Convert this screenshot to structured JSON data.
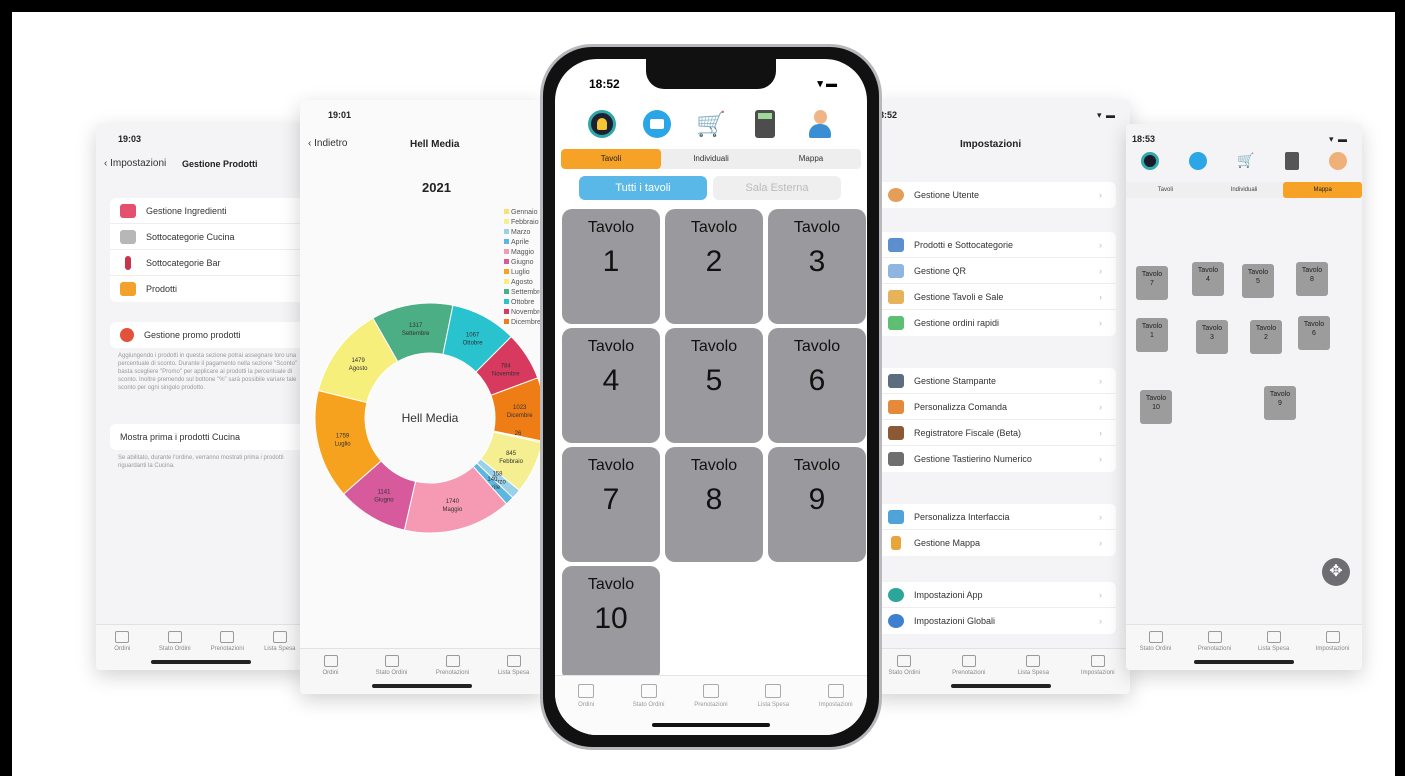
{
  "screen1": {
    "time": "19:03",
    "back": "Impostazioni",
    "title": "Gestione Prodotti",
    "cells": [
      "Gestione Ingredienti",
      "Sottocategorie Cucina",
      "Sottocategorie Bar",
      "Prodotti"
    ],
    "promo": "Gestione promo prodotti",
    "promo_note": "Aggiungendo i prodotti in questa sezione potrai assegnare loro una percentuale di sconto. Durante il pagamento nella sezione \"Sconto\" basta scegliere \"Promo\" per applicare ai prodotti la percentuale di sconto. Inoltre premendo sul bottone \"%\" sarà possibile variare tale sconto per ogni singolo prodotto.",
    "kitchen_first": "Mostra prima i prodotti Cucina",
    "kitchen_note": "Se abilitato, durante l'ordine, verranno mostrati prima i prodotti riguardanti la Cucina.",
    "tabs": [
      "Ordini",
      "Stato Ordini",
      "Prenotazioni",
      "Lista Spesa"
    ]
  },
  "screen2": {
    "time": "19:01",
    "back": "Indietro",
    "title": "Hell Media",
    "year": "2021",
    "center_label": "Hell Media",
    "tabs": [
      "Ordini",
      "Stato Ordini",
      "Prenotazioni",
      "Lista Spesa"
    ]
  },
  "chart_data": {
    "type": "pie",
    "title": "2021",
    "categories": [
      "Settembre",
      "Ottobre",
      "Novembre",
      "Dicembre",
      "Gennaio",
      "Febbraio",
      "Marzo",
      "Aprile",
      "Maggio",
      "Giugno",
      "Luglio",
      "Agosto"
    ],
    "values": [
      1317,
      1067,
      784,
      1023,
      26,
      845,
      158,
      140,
      1740,
      1141,
      1759,
      1479
    ],
    "colors": [
      "#4cae84",
      "#28c3cf",
      "#d7395f",
      "#ef7d16",
      "#f9e176",
      "#f5ef92",
      "#9ad0e8",
      "#5cb7e0",
      "#f59ab2",
      "#d65a9c",
      "#f6a21e",
      "#f6ef7c"
    ],
    "legend": [
      "Gennaio",
      "Febbraio",
      "Marzo",
      "Aprile",
      "Maggio",
      "Giugno",
      "Luglio",
      "Agosto",
      "Settembre",
      "Ottobre",
      "Novembre",
      "Dicembre"
    ],
    "legend_colors": [
      "#f9e176",
      "#f5ef92",
      "#9ad0e8",
      "#5cb7e0",
      "#f59ab2",
      "#d65a9c",
      "#f6a21e",
      "#f6ef7c",
      "#4cae84",
      "#28c3cf",
      "#d7395f",
      "#ef7d16"
    ]
  },
  "phone": {
    "time": "18:52",
    "status": "▾ ▬",
    "icons": [
      "bell-icon",
      "mail-icon",
      "cart-icon",
      "calculator-icon",
      "user-icon"
    ],
    "segments": [
      "Tavoli",
      "Individuali",
      "Mappa"
    ],
    "rooms": [
      "Tutti i tavoli",
      "Sala Esterna"
    ],
    "table_label": "Tavolo",
    "tables": [
      "1",
      "2",
      "3",
      "4",
      "5",
      "6",
      "7",
      "8",
      "9",
      "10"
    ],
    "tabs": [
      "Ordini",
      "Stato Ordini",
      "Prenotazioni",
      "Lista Spesa",
      "Impostazioni"
    ]
  },
  "screen4": {
    "time": "18:52",
    "title": "Impostazioni",
    "group1": [
      "Gestione Utente"
    ],
    "group2": [
      "Prodotti e Sottocategorie",
      "Gestione QR",
      "Gestione Tavoli e Sale",
      "Gestione ordini rapidi"
    ],
    "group3": [
      "Gestione Stampante",
      "Personalizza Comanda",
      "Registratore Fiscale (Beta)",
      "Gestione Tastierino Numerico"
    ],
    "group4": [
      "Personalizza Interfaccia",
      "Gestione Mappa"
    ],
    "group5": [
      "Impostazioni App",
      "Impostazioni Globali"
    ],
    "tabs": [
      "Stato Ordini",
      "Prenotazioni",
      "Lista Spesa",
      "Impostazioni"
    ]
  },
  "screen5": {
    "time": "18:53",
    "segments": [
      "Tavoli",
      "Individuali",
      "Mappa"
    ],
    "table_label": "Tavolo",
    "map_tables": [
      "7",
      "4",
      "5",
      "8",
      "1",
      "3",
      "2",
      "6",
      "10",
      "9"
    ],
    "tabs": [
      "Stato Ordini",
      "Prenotazioni",
      "Lista Spesa",
      "Impostazioni"
    ]
  }
}
